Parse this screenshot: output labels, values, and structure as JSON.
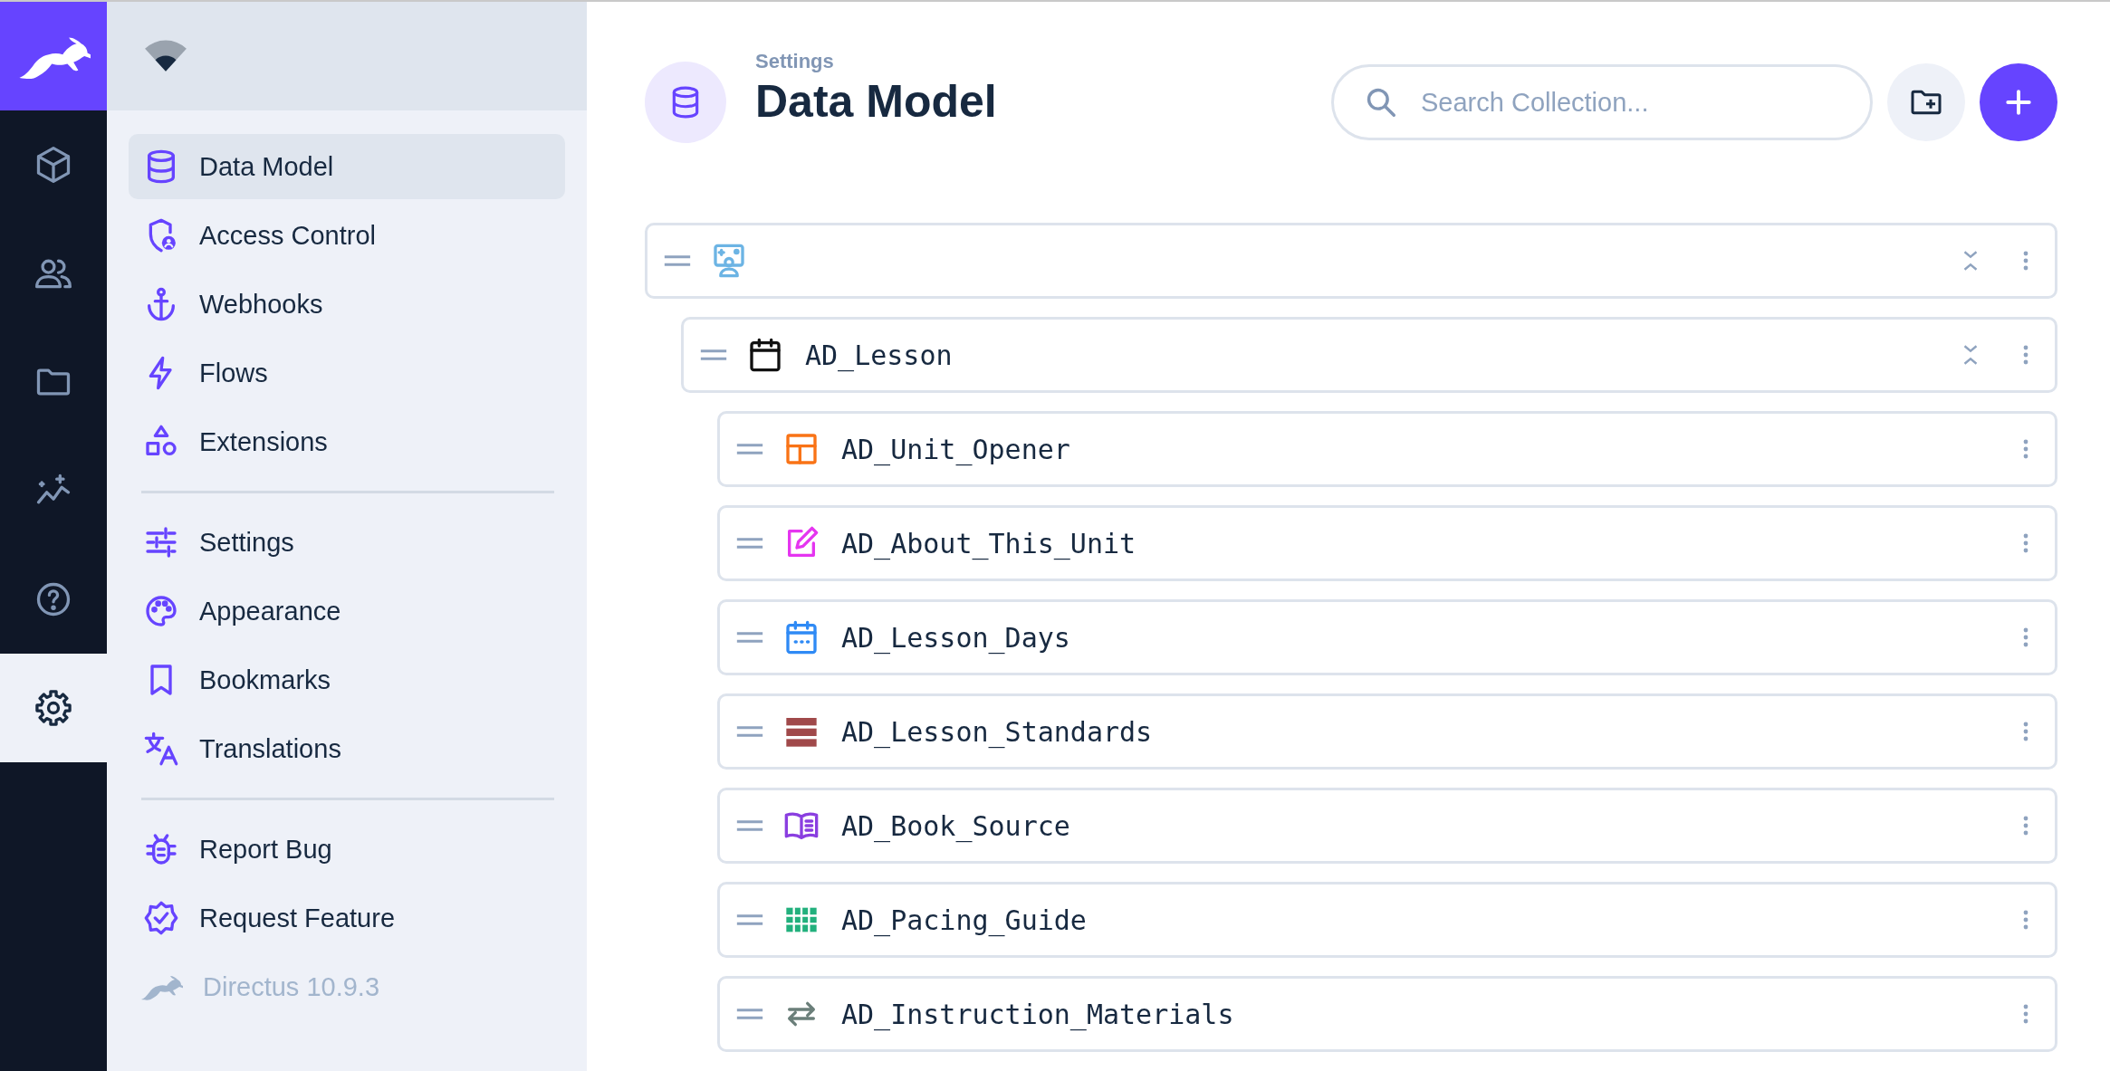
{
  "rail": {
    "items": [
      {
        "kind": "cube",
        "selected": false
      },
      {
        "kind": "users",
        "selected": false
      },
      {
        "kind": "folder",
        "selected": false
      },
      {
        "kind": "insights",
        "selected": false
      },
      {
        "kind": "help",
        "selected": false
      },
      {
        "kind": "gear",
        "selected": true
      }
    ]
  },
  "sidebar": {
    "groups": [
      {
        "items": [
          {
            "label": "Data Model",
            "kind": "database",
            "selected": true
          },
          {
            "label": "Access Control",
            "kind": "shield-person",
            "selected": false
          },
          {
            "label": "Webhooks",
            "kind": "anchor",
            "selected": false
          },
          {
            "label": "Flows",
            "kind": "bolt",
            "selected": false
          },
          {
            "label": "Extensions",
            "kind": "shapes",
            "selected": false
          }
        ]
      },
      {
        "items": [
          {
            "label": "Settings",
            "kind": "sliders",
            "selected": false
          },
          {
            "label": "Appearance",
            "kind": "palette",
            "selected": false
          },
          {
            "label": "Bookmarks",
            "kind": "bookmark",
            "selected": false
          },
          {
            "label": "Translations",
            "kind": "translate",
            "selected": false
          }
        ]
      },
      {
        "items": [
          {
            "label": "Report Bug",
            "kind": "bug",
            "selected": false
          },
          {
            "label": "Request Feature",
            "kind": "verified",
            "selected": false
          }
        ]
      }
    ],
    "version": "Directus 10.9.3"
  },
  "header": {
    "breadcrumb": "Settings",
    "title": "Data Model",
    "search": {
      "placeholder": "Search Collection..."
    }
  },
  "collections": [
    {
      "kind": "presenter",
      "color": "#6cb4e4",
      "children": [
        {
          "name": "AD_Lesson",
          "kind": "calendar",
          "color": "#111111",
          "children": [
            {
              "name": "AD_Unit_Opener",
              "kind": "layout",
              "color": "#f97316"
            },
            {
              "name": "AD_About_This_Unit",
              "kind": "edit",
              "color": "#e535f0"
            },
            {
              "name": "AD_Lesson_Days",
              "kind": "calendar-dots",
              "color": "#2f8af5"
            },
            {
              "name": "AD_Lesson_Standards",
              "kind": "rows",
              "color": "#a0494a"
            },
            {
              "name": "AD_Book_Source",
              "kind": "book",
              "color": "#8a3ee0"
            },
            {
              "name": "AD_Pacing_Guide",
              "kind": "grid",
              "color": "#22b07d"
            },
            {
              "name": "AD_Instruction_Materials",
              "kind": "swap",
              "color": "#6b7f7a"
            }
          ]
        }
      ]
    }
  ]
}
